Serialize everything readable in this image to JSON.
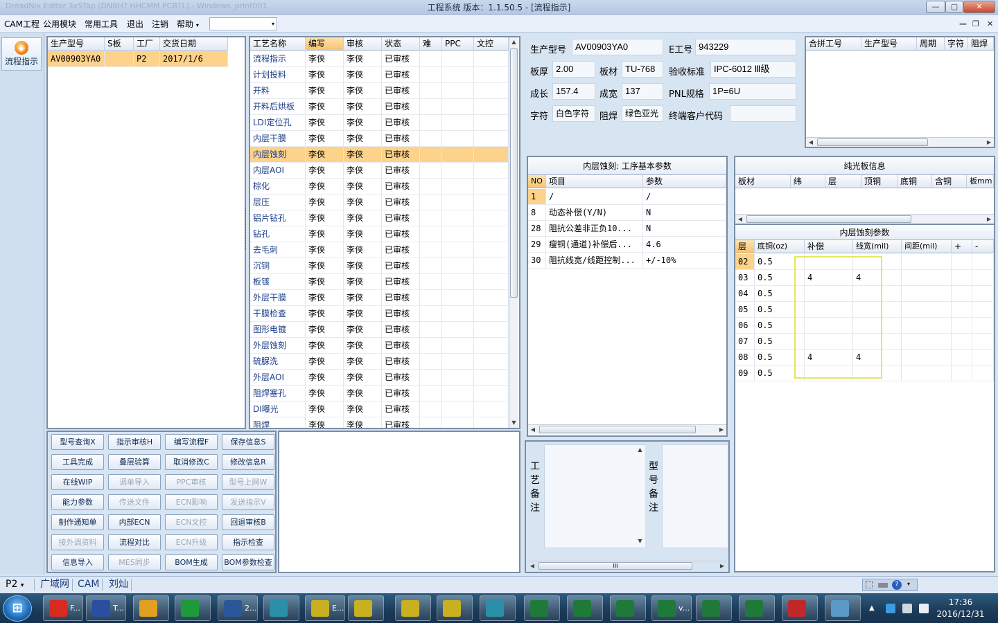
{
  "window": {
    "title": "工程系统   版本：1.1.50.5 - [流程指示]",
    "ghost_title": "DreadNix Editor 3x5Tap (DNBH? HHCMM PCBTL) - Windows_print001",
    "btn_min": "—",
    "btn_max": "▢",
    "btn_close": "✕"
  },
  "menu": {
    "items": [
      "CAM工程",
      "公用模块",
      "常用工具",
      "退出",
      "注销",
      "帮助"
    ],
    "help_arrow": "▾",
    "combo_value": "",
    "combo_arrow": "▾",
    "mdi_min": "—",
    "mdi_restore": "❐",
    "mdi_close": "✕"
  },
  "leftnav": {
    "flow_button": "流程指示",
    "flow_icon_glyph": "◉"
  },
  "orders": {
    "columns": [
      "生产型号",
      "S板",
      "工厂",
      "交货日期"
    ],
    "rows": [
      {
        "model": "AV00903YA0",
        "s": "",
        "factory": "P2",
        "date": "2017/1/6",
        "selected": true
      }
    ]
  },
  "processes": {
    "columns": [
      "工艺名称",
      "编写",
      "审核",
      "状态",
      "难",
      "PPC",
      "文控"
    ],
    "rows": [
      {
        "name": "流程指示",
        "writer": "李侠",
        "reviewer": "李侠",
        "status": "已审核"
      },
      {
        "name": "计划投料",
        "writer": "李侠",
        "reviewer": "李侠",
        "status": "已审核"
      },
      {
        "name": "开料",
        "writer": "李侠",
        "reviewer": "李侠",
        "status": "已审核"
      },
      {
        "name": "开料后烘板",
        "writer": "李侠",
        "reviewer": "李侠",
        "status": "已审核"
      },
      {
        "name": "LDI定位孔",
        "writer": "李侠",
        "reviewer": "李侠",
        "status": "已审核"
      },
      {
        "name": "内层干膜",
        "writer": "李侠",
        "reviewer": "李侠",
        "status": "已审核"
      },
      {
        "name": "内层蚀刻",
        "writer": "李侠",
        "reviewer": "李侠",
        "status": "已审核",
        "selected": true
      },
      {
        "name": "内层AOI",
        "writer": "李侠",
        "reviewer": "李侠",
        "status": "已审核"
      },
      {
        "name": "棕化",
        "writer": "李侠",
        "reviewer": "李侠",
        "status": "已审核"
      },
      {
        "name": "层压",
        "writer": "李侠",
        "reviewer": "李侠",
        "status": "已审核"
      },
      {
        "name": "铝片钻孔",
        "writer": "李侠",
        "reviewer": "李侠",
        "status": "已审核"
      },
      {
        "name": "钻孔",
        "writer": "李侠",
        "reviewer": "李侠",
        "status": "已审核"
      },
      {
        "name": "去毛刺",
        "writer": "李侠",
        "reviewer": "李侠",
        "status": "已审核"
      },
      {
        "name": "沉铜",
        "writer": "李侠",
        "reviewer": "李侠",
        "status": "已审核"
      },
      {
        "name": "板镀",
        "writer": "李侠",
        "reviewer": "李侠",
        "status": "已审核"
      },
      {
        "name": "外层干膜",
        "writer": "李侠",
        "reviewer": "李侠",
        "status": "已审核"
      },
      {
        "name": "干膜检查",
        "writer": "李侠",
        "reviewer": "李侠",
        "status": "已审核"
      },
      {
        "name": "图形电镀",
        "writer": "李侠",
        "reviewer": "李侠",
        "status": "已审核"
      },
      {
        "name": "外层蚀刻",
        "writer": "李侠",
        "reviewer": "李侠",
        "status": "已审核"
      },
      {
        "name": "硫脲洗",
        "writer": "李侠",
        "reviewer": "李侠",
        "status": "已审核"
      },
      {
        "name": "外层AOI",
        "writer": "李侠",
        "reviewer": "李侠",
        "status": "已审核"
      },
      {
        "name": "阻焊塞孔",
        "writer": "李侠",
        "reviewer": "李侠",
        "status": "已审核"
      },
      {
        "name": "DI曝光",
        "writer": "李侠",
        "reviewer": "李侠",
        "status": "已审核"
      },
      {
        "name": "阻焊",
        "writer": "李侠",
        "reviewer": "李侠",
        "status": "已审核"
      }
    ]
  },
  "buttons": [
    [
      "型号查询X",
      "指示审核H",
      "编写流程F",
      "保存信息S"
    ],
    [
      "工具完成",
      "叠层验算",
      "取消修改C",
      "修改信息R"
    ],
    [
      "在线WIP",
      "调单导入",
      "PPC审核",
      "型号上网W"
    ],
    [
      "能力参数",
      "传送文件",
      "ECN影响",
      "发送指示V"
    ],
    [
      "制作通知单",
      "内部ECN",
      "ECN文控",
      "回退审核B"
    ],
    [
      "接外调资料",
      "流程对比",
      "ECN升级",
      "指示检查"
    ],
    [
      "信息导入",
      "MES同步",
      "BOM生成",
      "BOM参数检查"
    ]
  ],
  "buttons_disabled": [
    [
      false,
      false,
      false,
      false
    ],
    [
      false,
      false,
      false,
      false
    ],
    [
      false,
      true,
      true,
      true
    ],
    [
      false,
      true,
      true,
      true
    ],
    [
      false,
      false,
      true,
      false
    ],
    [
      true,
      false,
      true,
      false
    ],
    [
      false,
      true,
      false,
      false
    ]
  ],
  "info": {
    "model_label": "生产型号",
    "model": "AV00903YA0",
    "eno_label": "E工号",
    "eno": "943229",
    "thick_label": "板厚",
    "thick": "2.00",
    "material_label": "板材",
    "material": "TU-768",
    "std_label": "验收标准",
    "std": "IPC-6012 Ⅲ级",
    "len_label": "成长",
    "len": "157.4",
    "width_label": "成宽",
    "width": "137",
    "pnl_label": "PNL规格",
    "pnl": "1P=6U",
    "char_label": "字符",
    "char": "白色字符",
    "mask_label": "阻焊",
    "mask": "绿色亚光",
    "cust_label": "终端客户代码",
    "cust": ""
  },
  "merge": {
    "columns": [
      "合拼工号",
      "生产型号",
      "周期",
      "字符",
      "阻焊"
    ]
  },
  "params": {
    "title": "内层蚀刻: 工序基本参数",
    "columns": [
      "NO",
      "项目",
      "参数"
    ],
    "rows": [
      {
        "no": "1",
        "item": "/",
        "value": "/"
      },
      {
        "no": "8",
        "item": "动态补偿(Y/N)",
        "value": "N"
      },
      {
        "no": "28",
        "item": "阻抗公差非正负10...",
        "value": "N"
      },
      {
        "no": "29",
        "item": "瘦铜(通道)补偿后...",
        "value": "4.6"
      },
      {
        "no": "30",
        "item": "阻抗线宽/线距控制...",
        "value": "+/-10%"
      }
    ]
  },
  "pure": {
    "title": "纯光板信息",
    "columns": [
      "板材",
      "纬",
      "层",
      "顶铜",
      "底铜",
      "含铜",
      "板mm"
    ]
  },
  "etch": {
    "title": "内层蚀刻参数",
    "columns": [
      "层",
      "底铜(oz)",
      "补偿",
      "线宽(mil)",
      "间距(mil)",
      "+",
      "-"
    ],
    "rows": [
      {
        "layer": "02",
        "base": "0.5",
        "comp": "",
        "lw": "",
        "sp": ""
      },
      {
        "layer": "03",
        "base": "0.5",
        "comp": "4",
        "lw": "4",
        "sp": ""
      },
      {
        "layer": "04",
        "base": "0.5",
        "comp": "",
        "lw": "",
        "sp": ""
      },
      {
        "layer": "05",
        "base": "0.5",
        "comp": "",
        "lw": "",
        "sp": ""
      },
      {
        "layer": "06",
        "base": "0.5",
        "comp": "",
        "lw": "",
        "sp": ""
      },
      {
        "layer": "07",
        "base": "0.5",
        "comp": "",
        "lw": "",
        "sp": ""
      },
      {
        "layer": "08",
        "base": "0.5",
        "comp": "4",
        "lw": "4",
        "sp": ""
      },
      {
        "layer": "09",
        "base": "0.5",
        "comp": "",
        "lw": "",
        "sp": ""
      }
    ]
  },
  "remarks": {
    "process_label": "工艺备注",
    "model_label": "型号备注",
    "process_value": "",
    "model_value": ""
  },
  "scroll": {
    "up": "▲",
    "down": "▼",
    "left": "◀",
    "right": "▶",
    "hgrip": "III"
  },
  "status": {
    "factory": "P2",
    "factory_arrow": "▾",
    "tabs": [
      "广域网",
      "CAM",
      "刘灿"
    ]
  },
  "taskbar": {
    "start_glyph": "⊞",
    "items": [
      {
        "label": "F...",
        "icon": "app-f-icon",
        "color": "#d62b1e"
      },
      {
        "label": "T...",
        "icon": "floppy-icon",
        "color": "#2a4fa0"
      },
      {
        "label": "",
        "icon": "shell-icon",
        "color": "#e0a020"
      },
      {
        "label": "",
        "icon": "p-app-icon",
        "color": "#1d9a3a"
      },
      {
        "label": "2...",
        "icon": "word-icon",
        "color": "#2b579a"
      },
      {
        "label": "",
        "icon": "camera-icon",
        "color": "#2a8fa8"
      },
      {
        "label": "E...",
        "icon": "x-window-icon",
        "color": "#c8b020"
      },
      {
        "label": "",
        "icon": "x-window-icon",
        "color": "#c8b020"
      },
      {
        "label": "",
        "icon": "x-window-icon",
        "color": "#c8b020"
      },
      {
        "label": "",
        "icon": "x-window-icon",
        "color": "#c8b020"
      },
      {
        "label": "",
        "icon": "camera-icon",
        "color": "#2a8fa8"
      },
      {
        "label": "",
        "icon": "excel-icon",
        "color": "#1f7a3a"
      },
      {
        "label": "",
        "icon": "excel-icon",
        "color": "#1f7a3a"
      },
      {
        "label": "",
        "icon": "excel-icon",
        "color": "#1f7a3a"
      },
      {
        "label": "v...",
        "icon": "excel-icon",
        "color": "#1f7a3a"
      },
      {
        "label": "",
        "icon": "excel-icon",
        "color": "#1f7a3a"
      },
      {
        "label": "",
        "icon": "excel-icon",
        "color": "#1f7a3a"
      },
      {
        "label": "",
        "icon": "pdf-icon",
        "color": "#c0282a"
      },
      {
        "label": "",
        "icon": "notepad-icon",
        "color": "#5a9ac8"
      }
    ],
    "time": "17:36",
    "date": "2016/12/31"
  }
}
